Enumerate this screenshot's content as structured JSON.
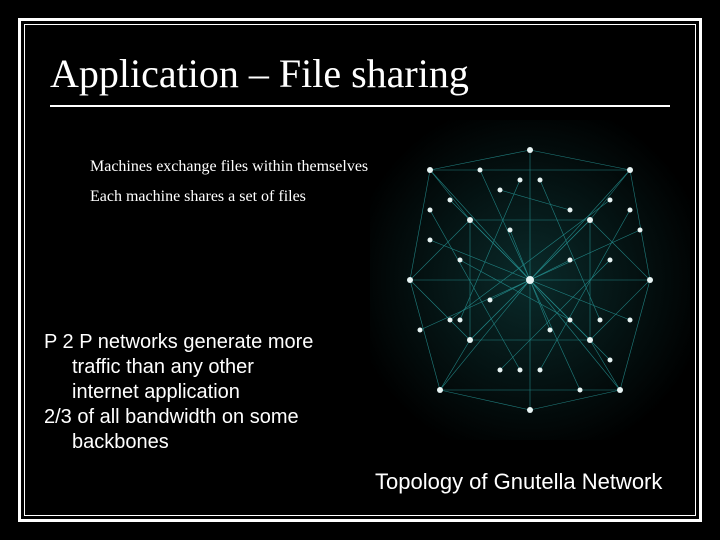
{
  "title": "Application – File sharing",
  "bullets": [
    "Machines exchange files within themselves",
    "Each machine shares a set of files"
  ],
  "body": {
    "line1": "P 2 P networks generate more",
    "line2": "traffic than any other",
    "line3": "internet application",
    "line4": "2/3 of all bandwidth on some",
    "line5": "backbones"
  },
  "caption": "Topology of Gnutella Network",
  "graph": {
    "description": "Dense mesh network visualization of Gnutella peer-to-peer topology",
    "node_color": "#cfe8e8",
    "edge_color": "#2aa5a5"
  }
}
